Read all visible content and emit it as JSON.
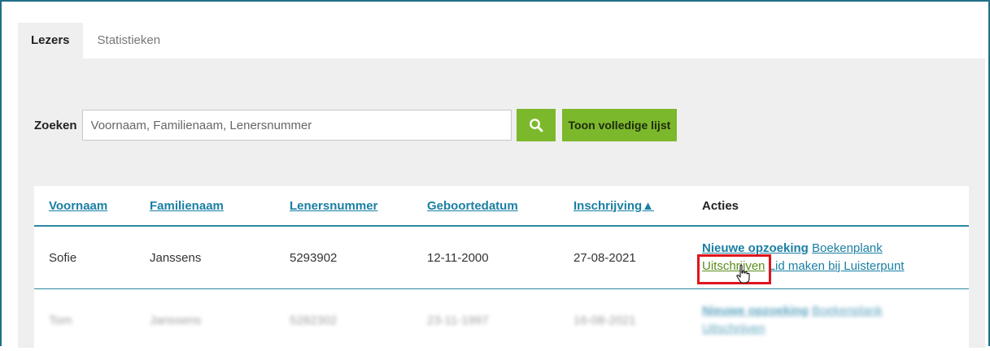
{
  "tabs": [
    {
      "label": "Lezers",
      "active": true
    },
    {
      "label": "Statistieken",
      "active": false
    }
  ],
  "search": {
    "label": "Zoeken",
    "placeholder": "Voornaam, Familienaam, Lenersnummer",
    "value": "",
    "search_icon": "search-icon",
    "full_list_label": "Toon volledige lijst"
  },
  "table": {
    "columns": [
      "Voornaam",
      "Familienaam",
      "Lenersnummer",
      "Geboortedatum",
      "Inschrijving▲",
      "Acties"
    ],
    "rows": [
      {
        "voornaam": "Sofie",
        "familienaam": "Janssens",
        "lenersnummer": "5293902",
        "geboortedatum": "12-11-2000",
        "inschrijving": "27-08-2021",
        "actions": {
          "new_search": "Nieuwe opzoeking",
          "bookshelf": "Boekenplank",
          "unsubscribe": "Uitschrijven",
          "make_member": "Lid maken bij Luisterpunt"
        }
      },
      {
        "voornaam": "Tom",
        "familienaam": "Janssens",
        "lenersnummer": "5282302",
        "geboortedatum": "23-11-1997",
        "inschrijving": "16-08-2021",
        "actions": {
          "new_search": "Nieuwe opzoeking",
          "bookshelf": "Boekenplank",
          "unsubscribe": "Uitschrijven"
        }
      }
    ]
  },
  "colors": {
    "accent_green": "#7cb82b",
    "link_blue": "#1a7fa3",
    "highlight_red": "#e0141d",
    "panel_gray": "#efefef"
  }
}
